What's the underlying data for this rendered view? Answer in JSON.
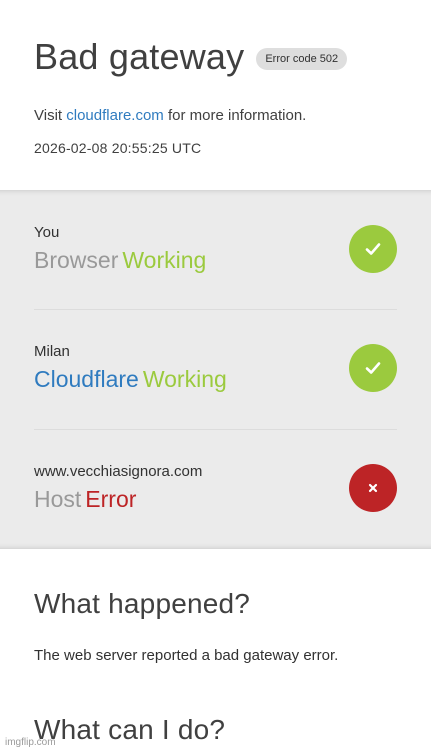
{
  "header": {
    "title": "Bad gateway",
    "error_badge": "Error code 502",
    "visit_prefix": "Visit",
    "visit_link": "cloudflare.com",
    "visit_suffix": "for more information.",
    "timestamp": "2026-02-08 20:55:25 UTC"
  },
  "status": [
    {
      "location": "You",
      "role": "Browser",
      "state": "Working",
      "icon": "check-icon"
    },
    {
      "location": "Milan",
      "role": "Cloudflare",
      "state": "Working",
      "icon": "check-icon"
    },
    {
      "location": "www.vecchiasignora.com",
      "role": "Host",
      "state": "Error",
      "icon": "close-icon"
    }
  ],
  "what_happened": {
    "title": "What happened?",
    "text": "The web server reported a bad gateway error."
  },
  "what_can_i_do": {
    "title": "What can I do?"
  },
  "watermark": "imgflip.com",
  "colors": {
    "link": "#2f7bbf",
    "working": "#9bca3e",
    "error": "#bd2426",
    "panel_bg": "#ebebeb"
  }
}
